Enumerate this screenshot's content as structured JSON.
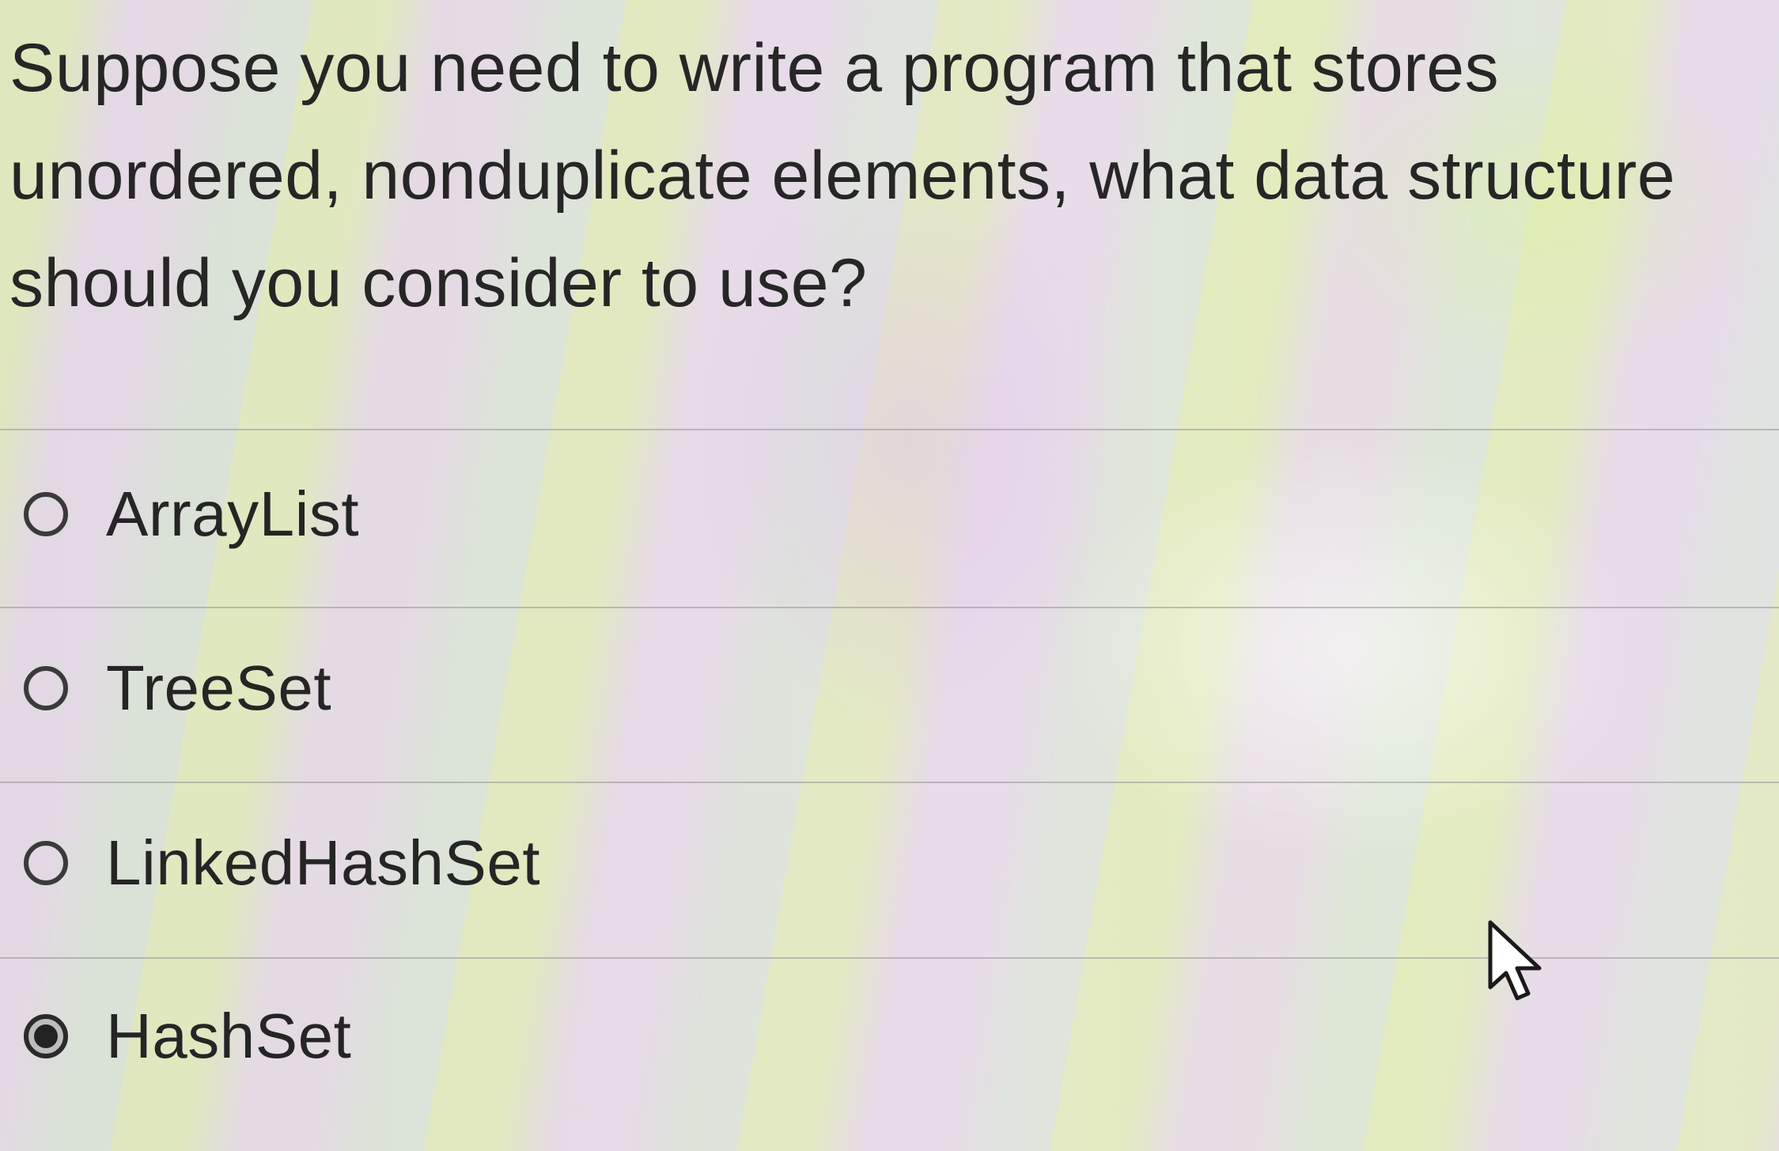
{
  "question": {
    "line1": "Suppose you need to write a program that stores",
    "line2": "unordered, nonduplicate elements, what data structure",
    "line3": "should you consider to use?"
  },
  "options": [
    {
      "label": "ArrayList",
      "selected": false
    },
    {
      "label": "TreeSet",
      "selected": false
    },
    {
      "label": "LinkedHashSet",
      "selected": false
    },
    {
      "label": "HashSet",
      "selected": true
    }
  ],
  "icons": {
    "radio_unselected": "radio-unselected-icon",
    "radio_selected": "radio-selected-icon",
    "pointer": "mouse-pointer-icon"
  }
}
